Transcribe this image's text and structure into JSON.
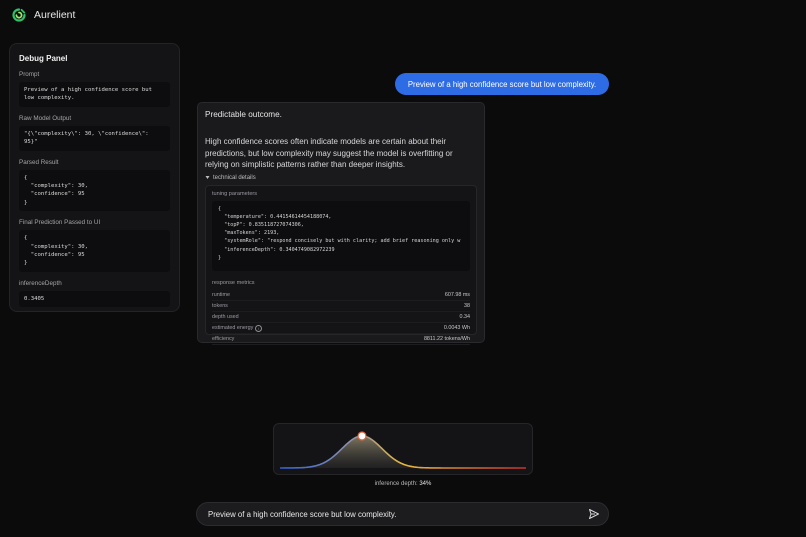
{
  "app": {
    "name": "Aurelient"
  },
  "debug": {
    "title": "Debug Panel",
    "sections": [
      {
        "label": "Prompt",
        "content": "Preview of a high confidence score but low complexity."
      },
      {
        "label": "Raw Model Output",
        "content": "\"{\\\"complexity\\\": 30, \\\"confidence\\\": 95}\""
      },
      {
        "label": "Parsed Result",
        "content": "{\n  \"complexity\": 30,\n  \"confidence\": 95\n}"
      },
      {
        "label": "Final Prediction Passed to UI",
        "content": "{\n  \"complexity\": 30,\n  \"confidence\": 95\n}"
      },
      {
        "label": "inferenceDepth",
        "content": "0.3405"
      }
    ]
  },
  "chat": {
    "user_message": "Preview of a high confidence score but low complexity.",
    "assistant": {
      "lead": "Predictable outcome.",
      "body": "High confidence scores often indicate models are certain about their predictions, but low complexity may suggest the model is overfitting or relying on simplistic patterns rather than deeper insights.",
      "details_toggle": "technical details",
      "tuning_title": "tuning parameters",
      "tuning_json": "{\n  \"temperature\": 0.44154614454188074,\n  \"topP\": 0.835118727074306,\n  \"maxTokens\": 2193,\n  \"systemRole\": \"respond concisely but with clarity; add brief reasoning only w\n  \"inferenceDepth\": 0.3404749082972239\n}",
      "metrics_title": "response metrics",
      "metrics": [
        {
          "label": "runtime",
          "value": "607.98 ms"
        },
        {
          "label": "tokens",
          "value": "38"
        },
        {
          "label": "depth used",
          "value": "0.34"
        },
        {
          "label": "estimated energy",
          "value": "0.0043 Wh",
          "info": true
        },
        {
          "label": "efficiency",
          "value": "8811.22 tokens/Wh"
        }
      ]
    }
  },
  "depth_meter": {
    "label": "inference depth:",
    "value_text": "34%",
    "value": 0.34,
    "colors": {
      "low": "#2d5fd6",
      "mid": "#e8b93a",
      "high": "#c8322a",
      "knob": "#ffffff"
    }
  },
  "composer": {
    "value": "Preview of a high confidence score but low complexity.",
    "placeholder": ""
  },
  "colors": {
    "accent": "#2e6ce6",
    "background": "#0b0b0c"
  }
}
